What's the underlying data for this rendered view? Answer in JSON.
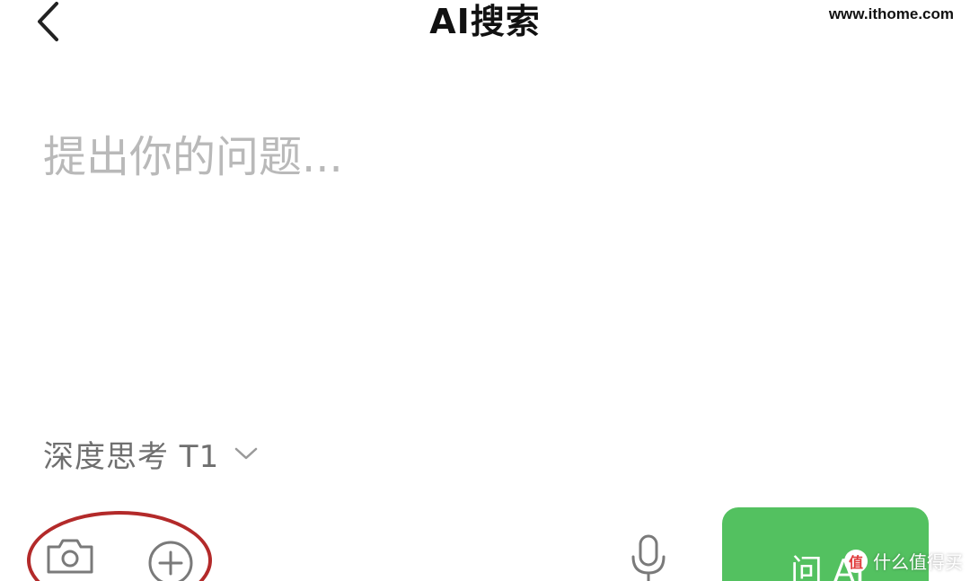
{
  "header": {
    "title": "AI搜索",
    "back_icon": "chevron-left-icon"
  },
  "watermark_top": "www.ithome.com",
  "input": {
    "placeholder": "提出你的问题..."
  },
  "mode": {
    "label": "深度思考 T1",
    "icon": "chevron-down-icon"
  },
  "toolbar": {
    "camera_icon": "camera-icon",
    "add_icon": "plus-circle-icon",
    "mic_icon": "microphone-icon",
    "ask_label": "问 AI",
    "annotation_color": "#b32a2a"
  },
  "watermark_bottom": {
    "badge": "值",
    "text": "什么值得买"
  },
  "colors": {
    "accent": "#53c160",
    "icon_gray": "#7a7a7a",
    "placeholder_gray": "#b9b9b9",
    "label_gray": "#6f6f6f"
  }
}
